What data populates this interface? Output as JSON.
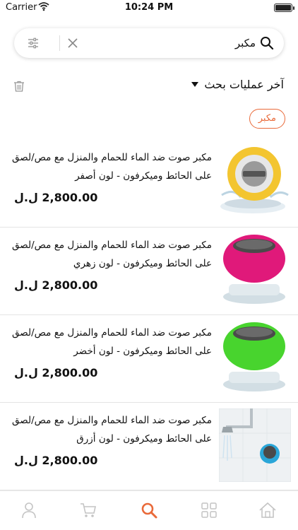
{
  "status_bar": {
    "carrier": "Carrier",
    "time": "10:24 PM"
  },
  "search": {
    "query": "مكبر",
    "icons": [
      "filter-icon",
      "clear-icon",
      "search-icon"
    ]
  },
  "recent": {
    "title": "آخر عمليات بحث",
    "chips": [
      "مكبر"
    ]
  },
  "products": [
    {
      "title_line1": "مكبر صوت ضد الماء للحمام والمنزل مع مص/لصق",
      "title_line2": "على الحائط  وميكرفون    - لون أصفر",
      "price": "2,800.00 ل.ل",
      "color": "#f3c530"
    },
    {
      "title_line1": "مكبر صوت ضد الماء للحمام والمنزل مع مص/لصق",
      "title_line2": "على الحائط  وميكرفون    - لون زهري",
      "price": "2,800.00 ل.ل",
      "color": "#e0197a"
    },
    {
      "title_line1": "مكبر صوت ضد الماء للحمام والمنزل مع مص/لصق",
      "title_line2": "على الحائط  وميكرفون    - لون أخضر",
      "price": "2,800.00 ل.ل",
      "color": "#48d42e"
    },
    {
      "title_line1": "مكبر صوت ضد الماء للحمام والمنزل مع مص/لصق",
      "title_line2": "على الحائط  وميكرفون    - لون أزرق",
      "price": "2,800.00 ل.ل",
      "color": "#2aa6d8"
    }
  ],
  "tab_bar": {
    "tabs": [
      "profile-icon",
      "cart-icon",
      "search-icon",
      "categories-icon",
      "home-icon"
    ],
    "active": "search-icon",
    "active_color": "#e96a3a",
    "inactive_color": "#c4c4c4"
  }
}
